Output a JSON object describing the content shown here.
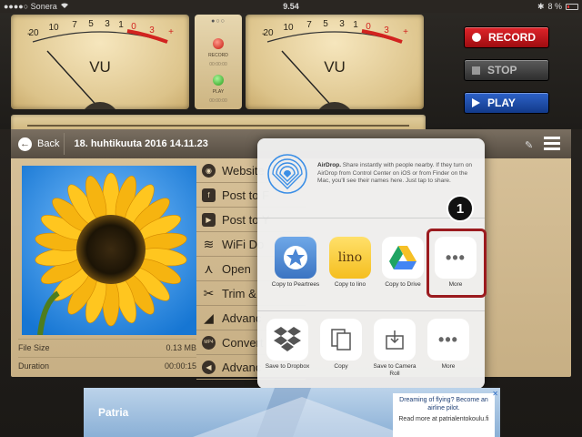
{
  "status_bar": {
    "carrier": "●●●●○ Sonera",
    "time": "9.54",
    "battery": "8 %",
    "wifi_icon": "wifi-icon",
    "bluetooth_icon": "bluetooth-icon"
  },
  "meters": {
    "scale_labels": [
      "20",
      "10",
      "7",
      "5",
      "3",
      "1",
      "0",
      "3",
      "+"
    ],
    "minus_sign": "-",
    "vu_label": "VU",
    "page_dots": "●○○",
    "record_label": "RECORD",
    "play_label": "PLAY",
    "time_readout": "00:00:00"
  },
  "transport": {
    "record": "RECORD",
    "stop": "STOP",
    "play": "PLAY",
    "record_color": "#d11a20",
    "stop_color": "#4a4a4a",
    "play_color": "#1f4fb0"
  },
  "navbar": {
    "back": "Back",
    "title": "18. huhtikuuta 2016 14.11.23"
  },
  "recording_info": [
    {
      "label": "File Size",
      "value": "0.13 MB"
    },
    {
      "label": "Duration",
      "value": "00:00:15"
    }
  ],
  "menu_items": [
    {
      "label": "Website",
      "icon": "globe-icon",
      "glyph": "◉"
    },
    {
      "label": "Post to F",
      "icon": "facebook-icon",
      "glyph": "f"
    },
    {
      "label": "Post to Y",
      "icon": "youtube-icon",
      "glyph": "▶"
    },
    {
      "label": "WiFi Do",
      "icon": "wifi-icon",
      "glyph": "≋"
    },
    {
      "label": "Open",
      "icon": "open-in-icon",
      "glyph": "⋏"
    },
    {
      "label": "Trim &",
      "icon": "scissors-icon",
      "glyph": "✂"
    },
    {
      "label": "Advanc",
      "icon": "waveform-icon",
      "glyph": "◢"
    },
    {
      "label": "Convert",
      "icon": "mp4-icon",
      "glyph": "MP4"
    },
    {
      "label": "Advanc",
      "icon": "speaker-icon",
      "glyph": "◀"
    }
  ],
  "share_sheet": {
    "airdrop_title": "AirDrop.",
    "airdrop_text": " Share instantly with people nearby. If they turn on AirDrop from Control Center on iOS or from Finder on the Mac, you'll see their names here. Just tap to share.",
    "apps": [
      {
        "label": "Copy to Peartrees",
        "icon": "star-icon"
      },
      {
        "label": "Copy to lino",
        "icon": "lino-icon",
        "icon_text": "lino"
      },
      {
        "label": "Copy to Drive",
        "icon": "google-drive-icon"
      },
      {
        "label": "More",
        "icon": "more-icon",
        "icon_text": "•••"
      }
    ],
    "actions": [
      {
        "label": "Save to Dropbox",
        "icon": "dropbox-icon"
      },
      {
        "label": "Copy",
        "icon": "copy-icon"
      },
      {
        "label": "Save to Camera Roll",
        "icon": "save-to-camera-roll-icon"
      },
      {
        "label": "More",
        "icon": "more-icon",
        "icon_text": "•••"
      }
    ]
  },
  "callout": {
    "number": "1",
    "color": "#9b1b1f"
  },
  "ad": {
    "brand": "Patria",
    "headline": "Dreaming of flying? Become an airline pilot.",
    "cta": "Read more at patrialentokoulu.fi",
    "close": "✕"
  }
}
